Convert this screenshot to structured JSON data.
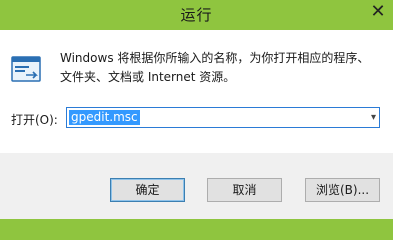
{
  "window": {
    "title": "运行",
    "close_symbol": "✕"
  },
  "description": {
    "line1": "Windows 将根据你所输入的名称，为你打开相应的程序、",
    "line2": "文件夹、文档或 Internet 资源。"
  },
  "open_field": {
    "label": "打开(O):",
    "value": "gpedit.msc",
    "dropdown_icon": "chevron-down-icon"
  },
  "buttons": {
    "ok": "确定",
    "cancel": "取消",
    "browse": "浏览(B)..."
  },
  "colors": {
    "accent": "#8fc53f",
    "selection": "#3399ff",
    "focus_border": "#2b7bd6"
  }
}
